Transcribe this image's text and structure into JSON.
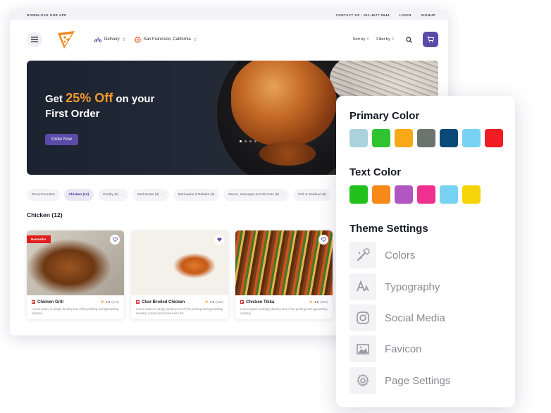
{
  "site": {
    "topbar": {
      "left": "DOWNLOAD OUR APP",
      "contact": "CONTACT US : 011-4677-5544",
      "login": "LOGIN",
      "signup": "SIGNUP"
    },
    "nav": {
      "delivery": "Delivery",
      "location": "San Francisco, California",
      "sort": "Sort by",
      "filter": "Filter by"
    },
    "hero": {
      "line1_pre": "Get",
      "line1_highlight": "25% Off",
      "line1_post": "on your",
      "line2": "First Order",
      "button": "Order Now"
    },
    "filters": [
      {
        "label": "Recommended",
        "active": false,
        "dropdown": false
      },
      {
        "label": "Chicken (12)",
        "active": true,
        "dropdown": false
      },
      {
        "label": "Poultry (8)",
        "active": false,
        "dropdown": true
      },
      {
        "label": "Red Meats (8)",
        "active": false,
        "dropdown": true
      },
      {
        "label": "Marinades & Rebaks (8)",
        "active": false,
        "dropdown": false
      },
      {
        "label": "Bacon, Sausages & Cold Cuts (8)",
        "active": false,
        "dropdown": true
      },
      {
        "label": "Fish & Seafood (8)",
        "active": false,
        "dropdown": false
      }
    ],
    "section_title": "Chicken (12)",
    "cards": [
      {
        "name": "Chicken Grill",
        "rating": "4.5",
        "count": "(231)",
        "badge": "Bestseller",
        "desc": "Lorem ipsum is simply dummy text of the printing and typesetting industry."
      },
      {
        "name": "Char-Broiled Chicken",
        "rating": "4.8",
        "count": "(320)",
        "badge": "",
        "desc": "Lorem ipsum is simply dummy text of the printing and typesetting industry. Lorem ipsum has been the"
      },
      {
        "name": "Chicken Tikka",
        "rating": "4.8",
        "count": "(320)",
        "badge": "",
        "desc": "Lorem ipsum is simply dummy text of the printing and typesetting industry."
      }
    ],
    "colors": {
      "accent": "#5b4ba8",
      "offer": "#f39a2b",
      "badge": "#e21d1d"
    }
  },
  "panel": {
    "primary_title": "Primary Color",
    "primary_colors": [
      "#a9d2dd",
      "#2fc42f",
      "#f9a917",
      "#6b756f",
      "#0b4a78",
      "#78d2f2",
      "#f01c24"
    ],
    "text_title": "Text Color",
    "text_colors": [
      "#22c11c",
      "#f6891a",
      "#b157c1",
      "#f0308f",
      "#78d2f2",
      "#f7d40a"
    ],
    "theme_title": "Theme Settings",
    "settings": [
      {
        "label": "Colors",
        "icon": "palette-icon"
      },
      {
        "label": "Typography",
        "icon": "typography-icon"
      },
      {
        "label": "Social Media",
        "icon": "instagram-icon"
      },
      {
        "label": "Favicon",
        "icon": "image-icon"
      },
      {
        "label": "Page Settings",
        "icon": "gear-icon"
      }
    ]
  }
}
